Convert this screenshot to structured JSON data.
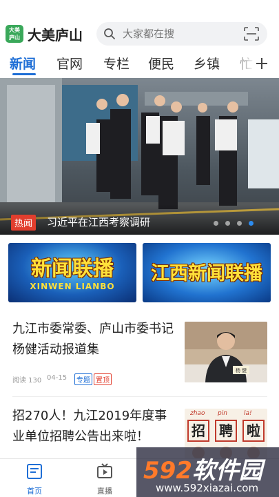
{
  "app": {
    "logo_text": "大美\n庐山",
    "title": "大美庐山",
    "brand_color": "#1f6fd6"
  },
  "search": {
    "placeholder": "大家都在搜",
    "icon": "search-icon",
    "scan_icon": "scan-icon"
  },
  "tabs": [
    {
      "label": "新闻",
      "active": true
    },
    {
      "label": "官网",
      "active": false
    },
    {
      "label": "专栏",
      "active": false
    },
    {
      "label": "便民",
      "active": false
    },
    {
      "label": "乡镇",
      "active": false
    },
    {
      "label": "忙",
      "active": false
    }
  ],
  "hero": {
    "tag": "热闻",
    "title": "习近平在江西考察调研",
    "slide_count": 4,
    "active_slide": 4
  },
  "banners": [
    {
      "title": "新闻联播",
      "subtitle": "XINWEN LIANBO"
    },
    {
      "title": "江西新闻联播",
      "subtitle": ""
    }
  ],
  "articles": [
    {
      "title": "九江市委常委、庐山市委书记杨健活动报道集",
      "reads_label": "阅读 130",
      "date": "04-15",
      "tags": [
        "专题",
        "置顶"
      ],
      "nameplate": "杨 健"
    },
    {
      "title": "招270人！九江2019年度事业单位招聘公告出来啦！",
      "thumb_words": [
        {
          "pinyin": "zhao",
          "char": "招"
        },
        {
          "pinyin": "pin",
          "char": "聘"
        },
        {
          "pinyin": "la!",
          "char": "啦"
        }
      ]
    }
  ],
  "bottom_nav": [
    {
      "label": "首页",
      "icon": "home-icon",
      "active": true
    },
    {
      "label": "直播",
      "icon": "live-icon",
      "active": false
    }
  ],
  "watermark": {
    "main_number": "592",
    "main_text": "软件园",
    "url": "www.592xiazai.com"
  }
}
